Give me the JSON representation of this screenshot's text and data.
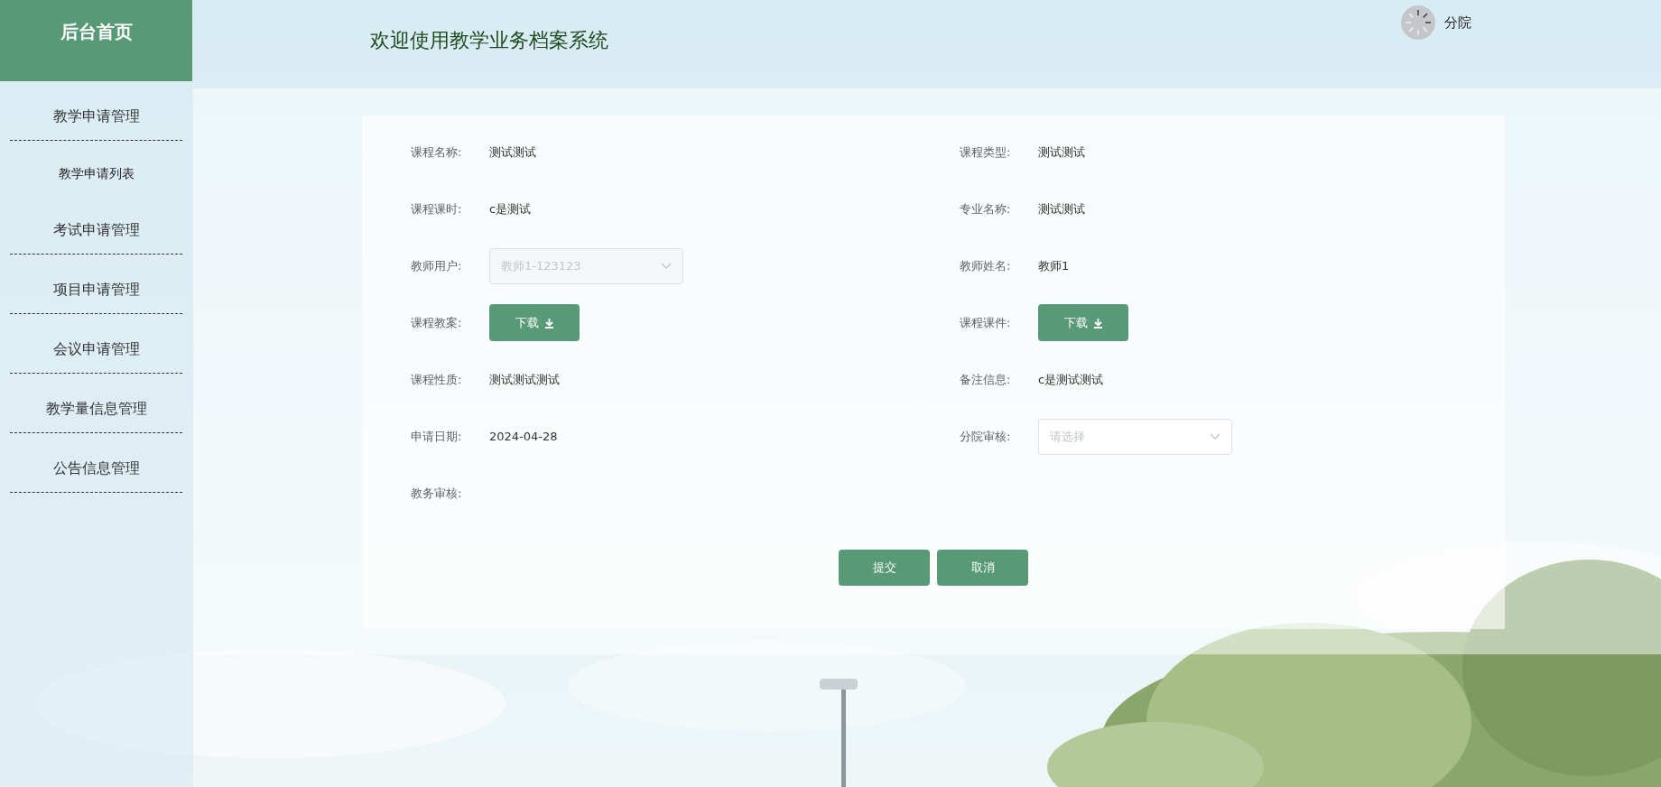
{
  "sidebar": {
    "title": "后台首页",
    "items": [
      {
        "label": "教学申请管理",
        "children": [
          {
            "label": "教学申请列表"
          }
        ]
      },
      {
        "label": "考试申请管理"
      },
      {
        "label": "项目申请管理"
      },
      {
        "label": "会议申请管理"
      },
      {
        "label": "教学量信息管理"
      },
      {
        "label": "公告信息管理"
      }
    ]
  },
  "header": {
    "title": "欢迎使用教学业务档案系统",
    "user": {
      "name": "分院"
    }
  },
  "form": {
    "fields": [
      {
        "kind": "text",
        "label": "课程名称:",
        "value": "测试测试"
      },
      {
        "kind": "text",
        "label": "课程类型:",
        "value": "测试测试"
      },
      {
        "kind": "text",
        "label": "课程课时:",
        "value": "c是测试"
      },
      {
        "kind": "text",
        "label": "专业名称:",
        "value": "测试测试"
      },
      {
        "kind": "select",
        "label": "教师用户:",
        "value": "教师1-123123",
        "disabled": true
      },
      {
        "kind": "text",
        "label": "教师姓名:",
        "value": "教师1"
      },
      {
        "kind": "download",
        "label": "课程教案:",
        "button": "下载"
      },
      {
        "kind": "download",
        "label": "课程课件:",
        "button": "下载"
      },
      {
        "kind": "text",
        "label": "课程性质:",
        "value": "测试测试测试"
      },
      {
        "kind": "text",
        "label": "备注信息:",
        "value": "c是测试测试"
      },
      {
        "kind": "text",
        "label": "申请日期:",
        "value": "2024-04-28"
      },
      {
        "kind": "select",
        "label": "分院审核:",
        "placeholder": "请选择"
      },
      {
        "kind": "text",
        "label": "教务审核:"
      }
    ],
    "buttons": [
      "提交",
      "取消"
    ]
  }
}
